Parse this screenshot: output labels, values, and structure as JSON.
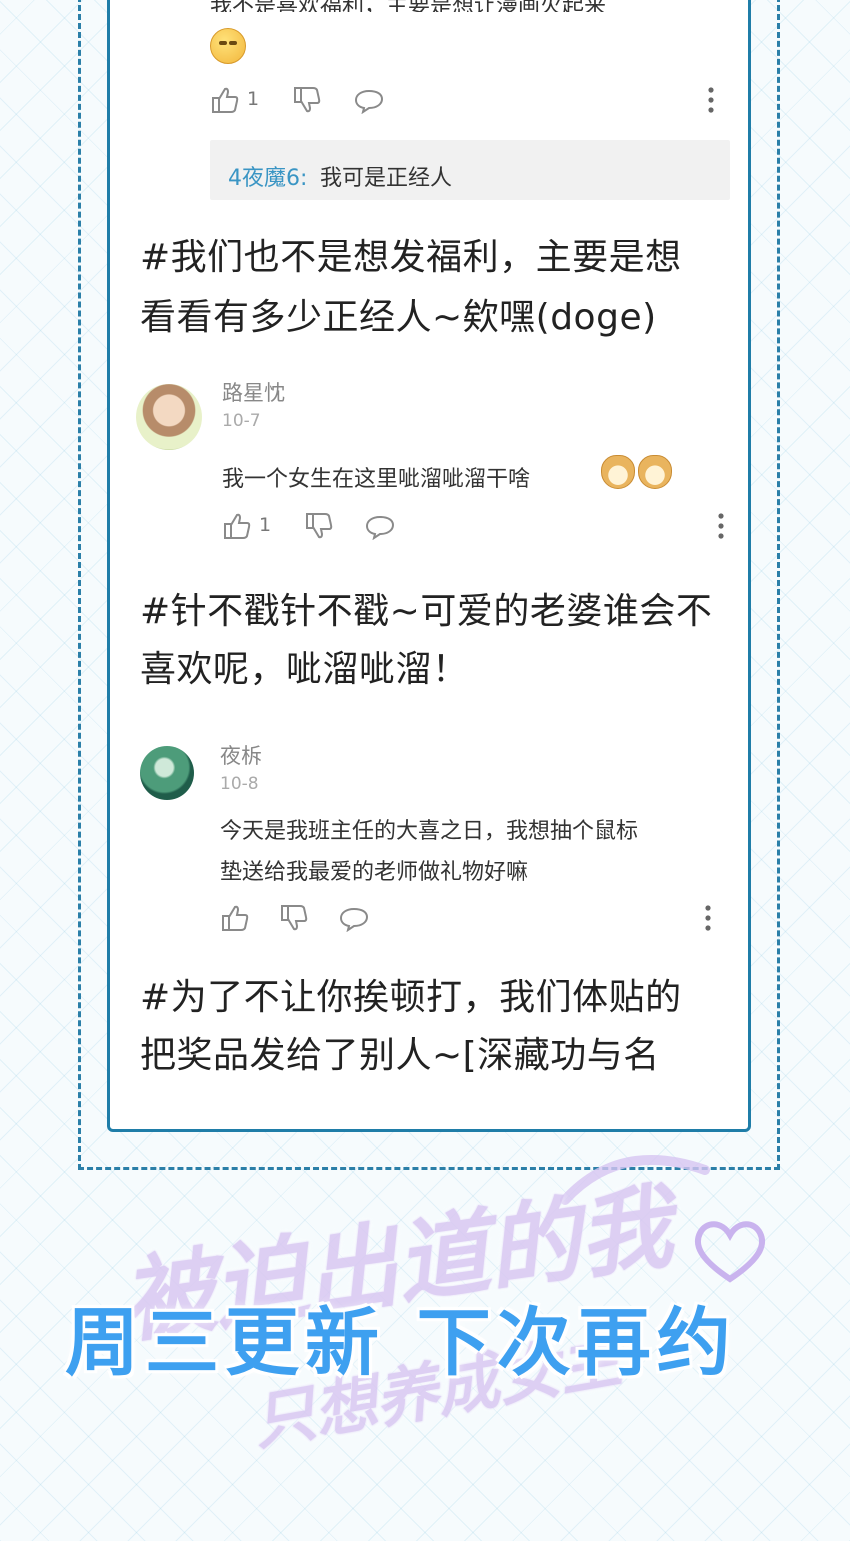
{
  "comment_top": {
    "text": "我不是喜欢福利，主要是想让漫画火起来",
    "like_count": "1"
  },
  "reply": {
    "name": "4夜魔6",
    "separator": ":",
    "text": "我可是正经人"
  },
  "note1": {
    "line1": "#我们也不是想发福利，主要是想",
    "line2": "看看有多少正经人~欸嘿(doge)"
  },
  "comment2": {
    "username": "路星忱",
    "date": "10-7",
    "text": "我一个女生在这里呲溜呲溜干啥",
    "like_count": "1"
  },
  "note2": {
    "line1": "#针不戳针不戳~可爱的老婆谁会不",
    "line2": "喜欢呢，呲溜呲溜！"
  },
  "comment3": {
    "username": "夜柝",
    "date": "10-8",
    "text_line1": "今天是我班主任的大喜之日，我想抽个鼠标",
    "text_line2": "垫送给我最爱的老师做礼物好嘛"
  },
  "note3": {
    "line1": "#为了不让你挨顿打，我们体贴的",
    "line2": "把奖品发给了别人~[深藏功与名"
  },
  "footer": {
    "banner": "周三更新 下次再约",
    "logo_line1": "被迫出道的我",
    "logo_line2": "只想养成女主"
  },
  "colors": {
    "frame": "#2b7fa8",
    "accent_blue": "#3ea0f0",
    "reply_name": "#3a95c4",
    "icon_gray": "#8a8a8a"
  },
  "icons": [
    "thumbs-up-icon",
    "thumbs-down-icon",
    "comment-bubble-icon",
    "more-vertical-icon"
  ]
}
